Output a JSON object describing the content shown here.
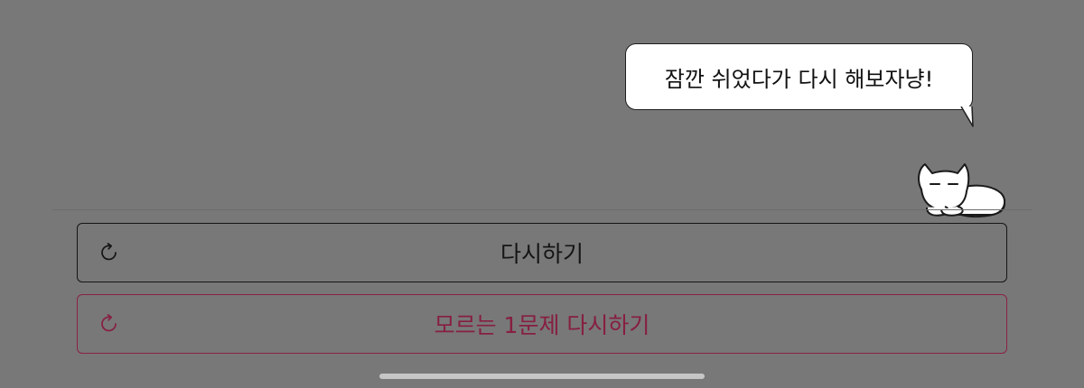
{
  "bubble": {
    "text": "잠깐 쉬었다가 다시 해보자냥!"
  },
  "buttons": {
    "retry_label": "다시하기",
    "retry_unknown_label": "모르는 1문제 다시하기"
  },
  "icons": {
    "retry": "refresh-icon",
    "mascot": "cat-mascot-icon"
  },
  "colors": {
    "overlay_background": "#787878",
    "primary_text": "#151515",
    "accent": "#861f40",
    "bubble_background": "#ffffff"
  }
}
